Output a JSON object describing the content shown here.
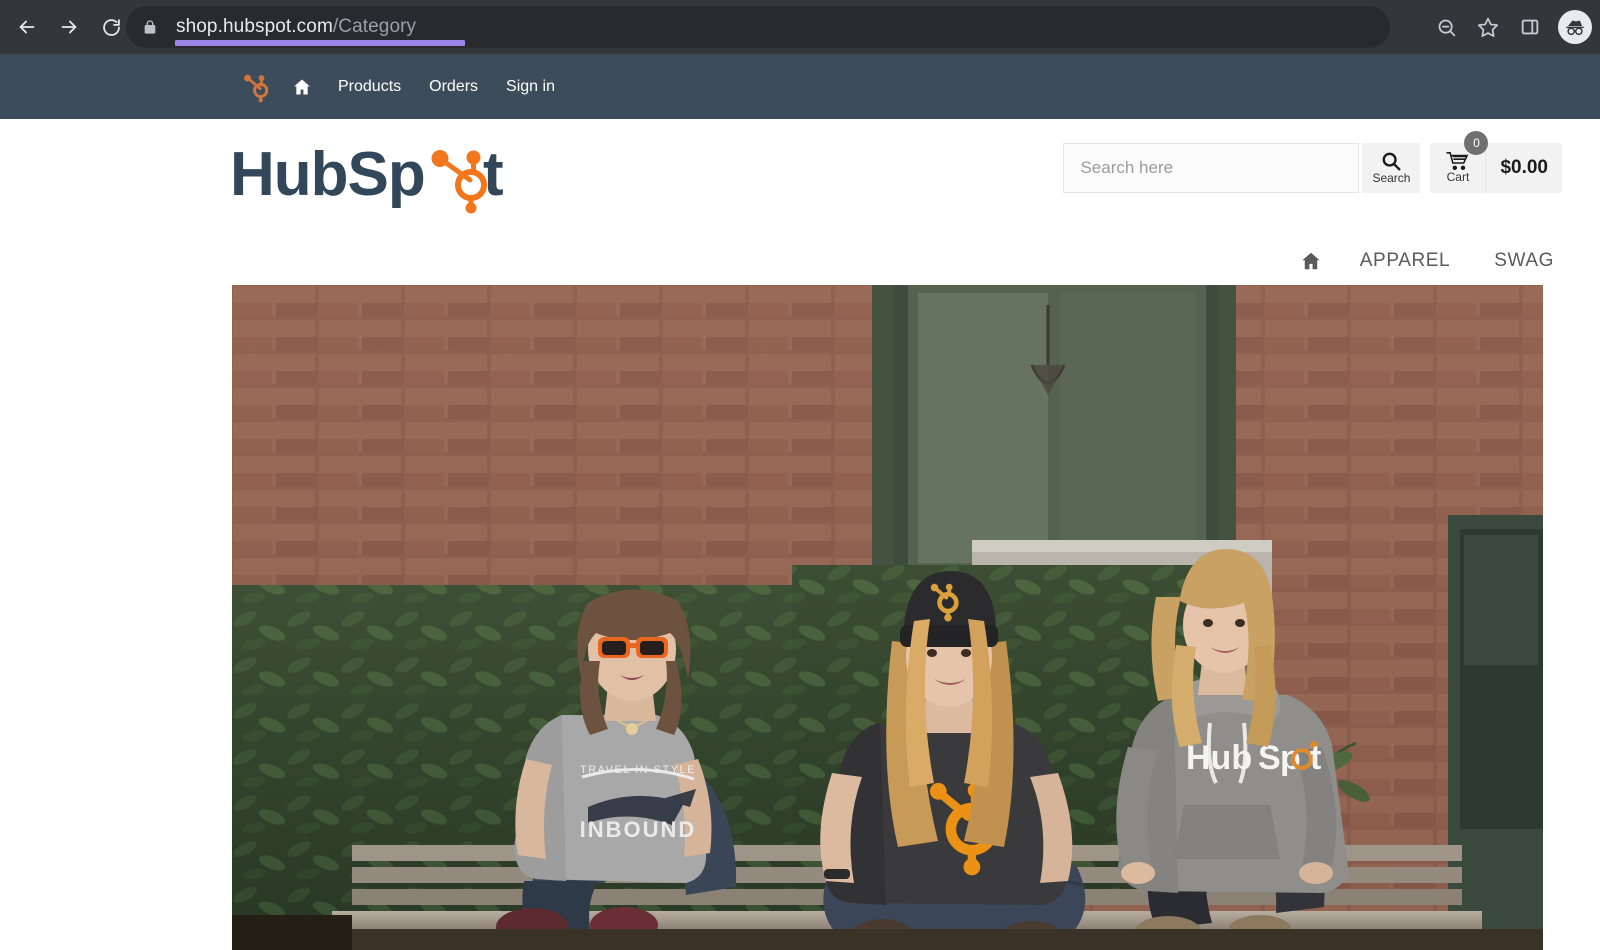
{
  "browser": {
    "back_icon": "arrow-left-icon",
    "forward_icon": "arrow-right-icon",
    "reload_icon": "reload-icon",
    "lock_icon": "lock-icon",
    "url_domain": "shop.hubspot.com",
    "url_path": "/Category",
    "zoom_out_icon": "zoom-out-icon",
    "bookmark_icon": "star-icon",
    "side_panel_icon": "side-panel-icon",
    "profile_icon": "incognito-avatar-icon",
    "highlight_color": "#9a85e8"
  },
  "topnav": {
    "logo_icon": "hubspot-sprocket-icon",
    "home_icon": "home-icon",
    "links": [
      {
        "label": "Products"
      },
      {
        "label": "Orders"
      },
      {
        "label": "Sign in"
      }
    ],
    "bg_color": "#3c4c5a"
  },
  "header": {
    "logo_text": "HubSpot",
    "logo_icon": "hubspot-sprocket-icon",
    "brand_orange": "#f2761b",
    "brand_dark": "#33475b"
  },
  "search": {
    "placeholder": "Search here",
    "value": "",
    "button_label": "Search",
    "button_icon": "search-icon"
  },
  "cart": {
    "icon": "shopping-cart-icon",
    "label": "Cart",
    "count": "0",
    "total": "$0.00"
  },
  "category_nav": {
    "home_icon": "home-icon",
    "items": [
      {
        "label": "APPAREL"
      },
      {
        "label": "SWAG"
      }
    ]
  },
  "hero": {
    "alt": "Three women sitting on a wooden bench in front of a brick wall wearing HubSpot apparel",
    "subjects": [
      {
        "position": "left",
        "description": "Woman with orange sunglasses in grey t-shirt",
        "apparel": "grey INBOUND t-shirt",
        "shirt_text_top": "TRAVEL IN STYLE",
        "shirt_text_main": "INBOUND"
      },
      {
        "position": "center",
        "description": "Woman with black HubSpot beanie sitting cross-legged",
        "apparel": "dark charcoal HubSpot sprocket t-shirt"
      },
      {
        "position": "right",
        "description": "Woman in grey HubSpot pullover hoodie",
        "apparel": "grey HubSpot hoodie"
      }
    ],
    "background": "red brick wall, green shrubs, wooden bench"
  }
}
